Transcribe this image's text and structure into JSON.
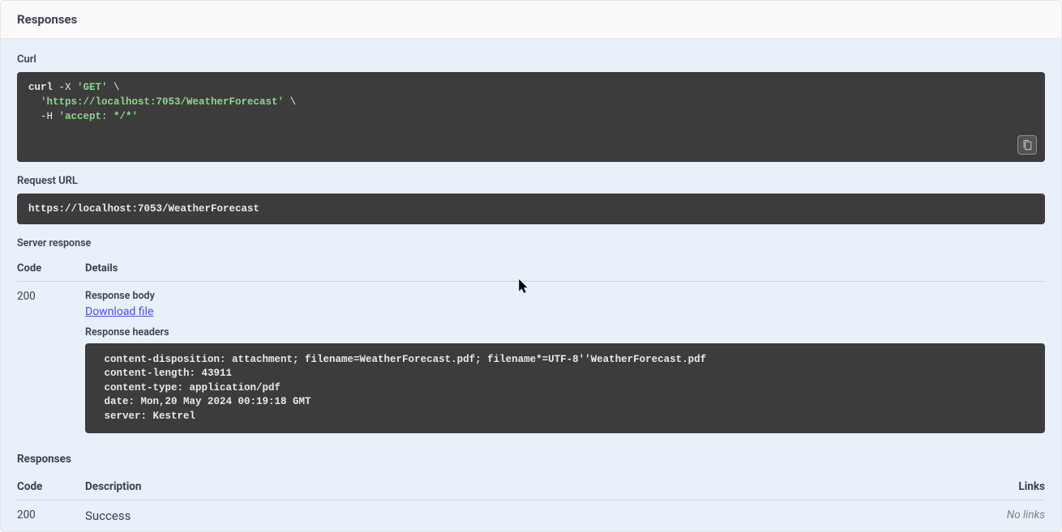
{
  "header": {
    "title": "Responses"
  },
  "curl": {
    "label": "Curl",
    "line1_cmd": "curl",
    "line1_flag": " -X ",
    "line1_method": "'GET'",
    "line1_cont": " \\",
    "line2_indent": "  ",
    "line2_url": "'https://localhost:7053/WeatherForecast'",
    "line2_cont": " \\",
    "line3_indent": "  ",
    "line3_flag": "-H ",
    "line3_hdr": "'accept: */*'"
  },
  "request_url": {
    "label": "Request URL",
    "value": "https://localhost:7053/WeatherForecast"
  },
  "server_response": {
    "label": "Server response",
    "col_code": "Code",
    "col_details": "Details",
    "code": "200",
    "body_label": "Response body",
    "download_link": "Download file",
    "headers_label": "Response headers",
    "headers_text": " content-disposition: attachment; filename=WeatherForecast.pdf; filename*=UTF-8''WeatherForecast.pdf \n content-length: 43911 \n content-type: application/pdf \n date: Mon,20 May 2024 00:19:18 GMT \n server: Kestrel "
  },
  "responses_list": {
    "label": "Responses",
    "col_code": "Code",
    "col_desc": "Description",
    "col_links": "Links",
    "code": "200",
    "desc": "Success",
    "links": "No links"
  }
}
